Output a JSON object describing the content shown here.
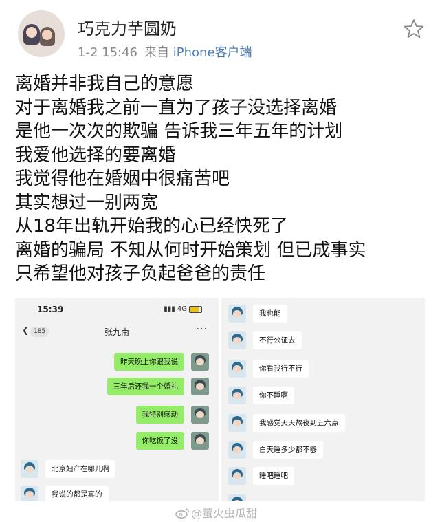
{
  "post": {
    "username": "巧克力芋圆奶",
    "date_time": "1-2 15:46",
    "source_prefix": "来自",
    "device": "iPhone客户端",
    "body_lines": [
      "离婚并非我自己的意愿",
      "对于离婚我之前一直为了孩子没选择离婚",
      "是他一次次的欺骗 告诉我三年五年的计划",
      "我爱他选择的要离婚",
      "我觉得他在婚姻中很痛苦吧",
      "其实想过一别两宽",
      "从18年出轨开始我的心已经快死了",
      "离婚的骗局 不知从何时开始策划 但已成事实",
      "只希望他对孩子负起爸爸的责任"
    ]
  },
  "chat_left": {
    "status_time": "15:39",
    "network": "4G",
    "back_count": "185",
    "contact_name": "张九南",
    "more": "···",
    "messages": [
      {
        "side": "sent",
        "text": "昨天晚上你跟我说"
      },
      {
        "side": "sent",
        "text": "三年后还我一个婚礼"
      },
      {
        "side": "sent",
        "text": "我特别感动"
      },
      {
        "side": "sent",
        "text": "你吃饭了没"
      },
      {
        "side": "recv",
        "text": "北京妇产在哪儿啊"
      },
      {
        "side": "recv",
        "text": "我说的都是真的"
      }
    ]
  },
  "chat_right": {
    "messages": [
      {
        "side": "recv",
        "text": "我也能"
      },
      {
        "side": "recv",
        "text": "不行公证去"
      },
      {
        "side": "recv",
        "text": "你看我行不行"
      },
      {
        "side": "recv",
        "text": "你不睡啊"
      },
      {
        "side": "recv",
        "text": "我感觉天天熬夜到五六点"
      },
      {
        "side": "recv",
        "text": "白天睡多少都不够"
      },
      {
        "side": "recv",
        "text": "睡吧睡吧"
      }
    ]
  },
  "watermark": "@萤火虫瓜甜",
  "colors": {
    "sent_bubble": "#95ec69",
    "recv_bubble": "#ffffff",
    "device_link": "#4e7fb5",
    "meta_gray": "#8a8a8a"
  }
}
